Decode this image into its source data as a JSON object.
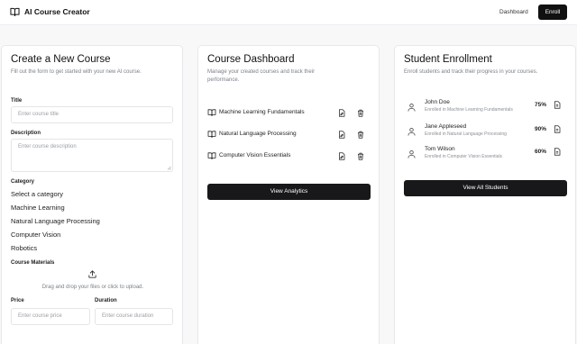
{
  "app": {
    "title": "AI Course Creator"
  },
  "nav": {
    "dashboard": "Dashboard",
    "enroll": "Enroll"
  },
  "create": {
    "title": "Create a New Course",
    "subtitle": "Fill out the form to get started with your new AI course.",
    "title_label": "Title",
    "title_placeholder": "Enter course title",
    "description_label": "Description",
    "description_placeholder": "Enter course description",
    "category_label": "Category",
    "category_options": [
      "Select a category",
      "Machine Learning",
      "Natural Language Processing",
      "Computer Vision",
      "Robotics"
    ],
    "materials_label": "Course Materials",
    "upload_text": "Drag and drop your files or click to upload.",
    "price_label": "Price",
    "price_placeholder": "Enter course price",
    "duration_label": "Duration",
    "duration_placeholder": "Enter course duration"
  },
  "dashboard": {
    "title": "Course Dashboard",
    "subtitle": "Manage your created courses and track their performance.",
    "courses": [
      {
        "name": "Machine Learning Fundamentals"
      },
      {
        "name": "Natural Language Processing"
      },
      {
        "name": "Computer Vision Essentials"
      }
    ],
    "analytics_button": "View Analytics"
  },
  "enrollment": {
    "title": "Student Enrollment",
    "subtitle": "Enroll students and track their progress in your courses.",
    "students": [
      {
        "name": "John Doe",
        "course": "Enrolled in Machine Learning Fundamentals",
        "progress": "75%"
      },
      {
        "name": "Jane Appleseed",
        "course": "Enrolled in Natural Language Processing",
        "progress": "90%"
      },
      {
        "name": "Tom Wilson",
        "course": "Enrolled in Computer Vision Essentials",
        "progress": "60%"
      }
    ],
    "all_students_button": "View All Students"
  },
  "icons": {
    "logo": "book-open-icon",
    "upload": "upload-icon",
    "course": "book-open-icon",
    "edit": "file-edit-icon",
    "delete": "trash-icon",
    "student": "user-icon",
    "report": "file-text-icon"
  },
  "colors": {
    "primary": "#111111",
    "background": "#f8f8f9",
    "muted_text": "#7a7f87"
  }
}
